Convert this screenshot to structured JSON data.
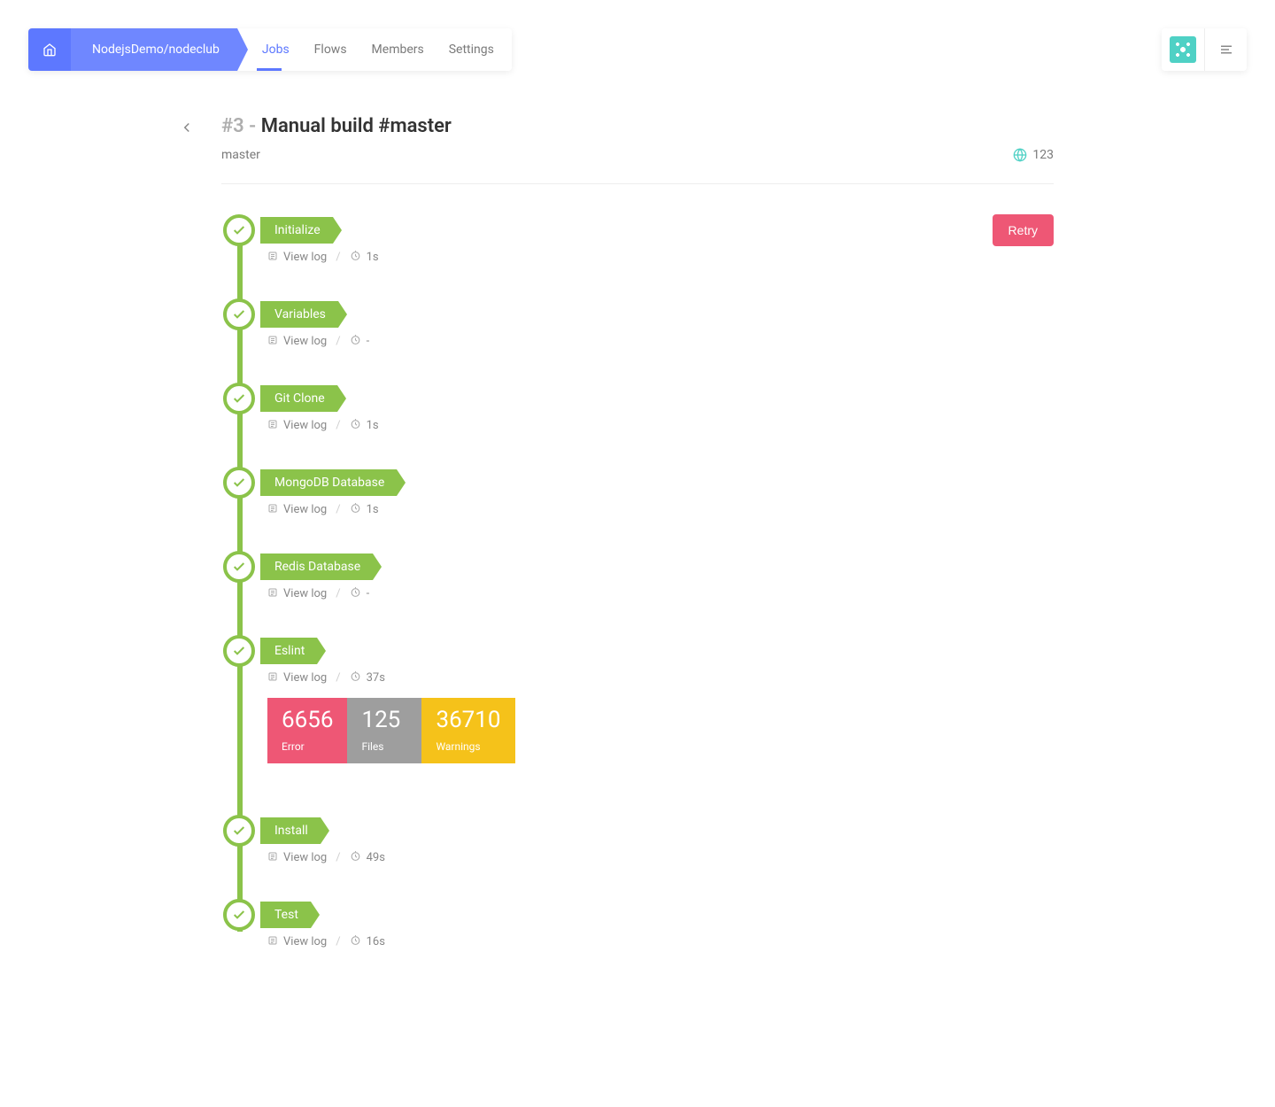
{
  "nav": {
    "breadcrumb": "NodejsDemo/nodeclub",
    "tabs": [
      "Jobs",
      "Flows",
      "Members",
      "Settings"
    ],
    "active_tab_index": 0
  },
  "page": {
    "title_prefix": "#3 - ",
    "title": "Manual build #master",
    "branch": "master",
    "badge_count": "123",
    "retry_label": "Retry"
  },
  "steps": [
    {
      "name": "Initialize",
      "view_log": "View log",
      "duration": "1s"
    },
    {
      "name": "Variables",
      "view_log": "View log",
      "duration": "-"
    },
    {
      "name": "Git Clone",
      "view_log": "View log",
      "duration": "1s"
    },
    {
      "name": "MongoDB Database",
      "view_log": "View log",
      "duration": "1s"
    },
    {
      "name": "Redis Database",
      "view_log": "View log",
      "duration": "-"
    },
    {
      "name": "Eslint",
      "view_log": "View log",
      "duration": "37s",
      "stats": [
        {
          "value": "6656",
          "label": "Error",
          "kind": "error"
        },
        {
          "value": "125",
          "label": "Files",
          "kind": "files"
        },
        {
          "value": "36710",
          "label": "Warnings",
          "kind": "warnings"
        }
      ]
    },
    {
      "name": "Install",
      "view_log": "View log",
      "duration": "49s"
    },
    {
      "name": "Test",
      "view_log": "View log",
      "duration": "16s"
    }
  ]
}
